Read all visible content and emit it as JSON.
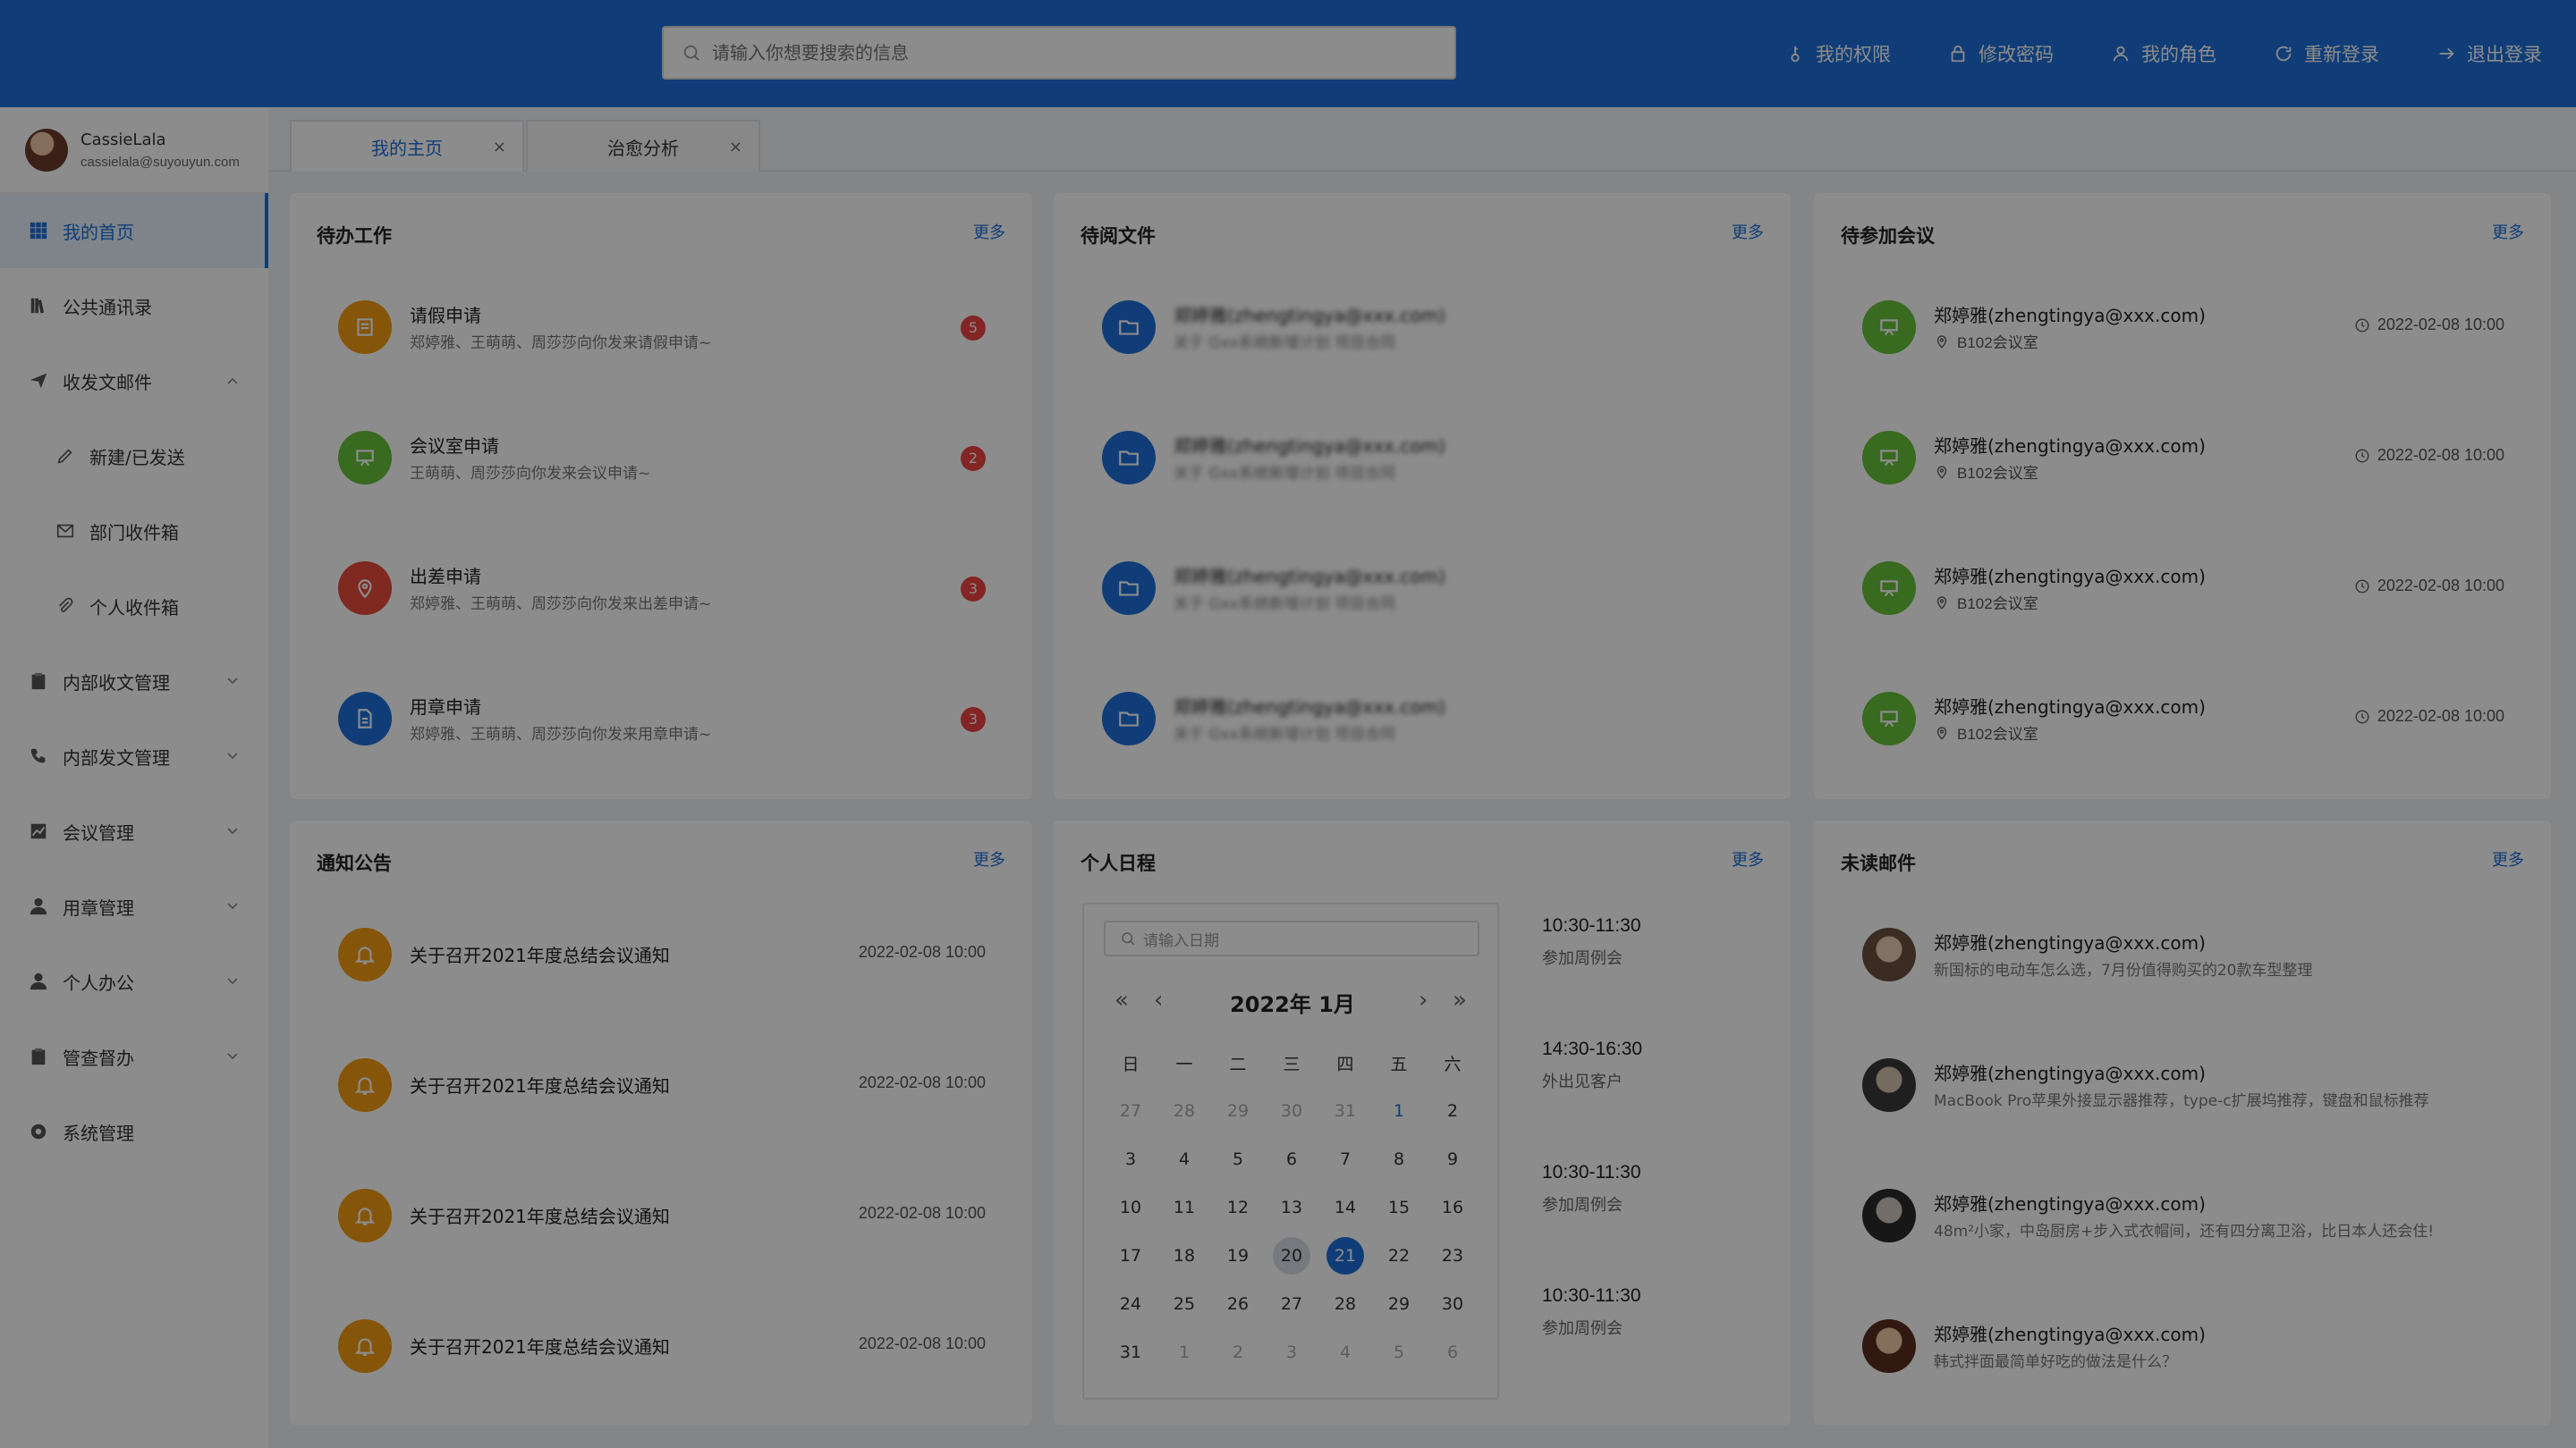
{
  "colors": {
    "primary": "#1e6fd9",
    "orange": "#f39c12",
    "green": "#67c23a",
    "red": "#e74c3c",
    "blue": "#1e6fd9"
  },
  "header": {
    "search_placeholder": "请输入你想要搜索的信息",
    "actions": [
      "我的权限",
      "修改密码",
      "我的角色",
      "重新登录",
      "退出登录"
    ]
  },
  "user": {
    "name": "CassieLala",
    "email": "cassielala@suyouyun.com"
  },
  "sidebar": {
    "items": [
      {
        "label": "我的首页",
        "icon": "grid-icon"
      },
      {
        "label": "公共通讯录",
        "icon": "book-icon"
      },
      {
        "label": "收发文邮件",
        "icon": "send-icon"
      },
      {
        "label": "新建/已发送",
        "icon": "pen-icon"
      },
      {
        "label": "部门收件箱",
        "icon": "mail-icon"
      },
      {
        "label": "个人收件箱",
        "icon": "clip-icon"
      },
      {
        "label": "内部收文管理",
        "icon": "clipboard-icon"
      },
      {
        "label": "内部发文管理",
        "icon": "phone-icon"
      },
      {
        "label": "会议管理",
        "icon": "chart-icon"
      },
      {
        "label": "用章管理",
        "icon": "person-icon"
      },
      {
        "label": "个人办公",
        "icon": "person-icon"
      },
      {
        "label": "管查督办",
        "icon": "clipboard-icon"
      },
      {
        "label": "系统管理",
        "icon": "gear-icon"
      }
    ]
  },
  "tabs": [
    {
      "label": "我的主页",
      "close": "×"
    },
    {
      "label": "治愈分析",
      "close": "×"
    }
  ],
  "more_label": "更多",
  "todo": {
    "title": "待办工作",
    "items": [
      {
        "title": "请假申请",
        "sub": "郑婷雅、王萌萌、周莎莎向你发来请假申请~",
        "count": "5"
      },
      {
        "title": "会议室申请",
        "sub": "王萌萌、周莎莎向你发来会议申请~",
        "count": "2"
      },
      {
        "title": "出差申请",
        "sub": "郑婷雅、王萌萌、周莎莎向你发来出差申请~",
        "count": "3"
      },
      {
        "title": "用章申请",
        "sub": "郑婷雅、王萌萌、周莎莎向你发来用章申请~",
        "count": "3"
      }
    ]
  },
  "files": {
    "title": "待阅文件",
    "items": [
      {
        "title": "郑婷雅(zhengtingya@xxx.com)",
        "sub": "关于 Gxx系统新增计划 项目合同"
      },
      {
        "title": "郑婷雅(zhengtingya@xxx.com)",
        "sub": "关于 Gxx系统新增计划 项目合同"
      },
      {
        "title": "郑婷雅(zhengtingya@xxx.com)",
        "sub": "关于 Gxx系统新增计划 项目合同"
      },
      {
        "title": "郑婷雅(zhengtingya@xxx.com)",
        "sub": "关于 Gxx系统新增计划 项目合同"
      }
    ]
  },
  "meetings": {
    "title": "待参加会议",
    "items": [
      {
        "title": "郑婷雅(zhengtingya@xxx.com)",
        "location": "B102会议室",
        "time": "2022-02-08 10:00"
      },
      {
        "title": "郑婷雅(zhengtingya@xxx.com)",
        "location": "B102会议室",
        "time": "2022-02-08 10:00"
      },
      {
        "title": "郑婷雅(zhengtingya@xxx.com)",
        "location": "B102会议室",
        "time": "2022-02-08 10:00"
      },
      {
        "title": "郑婷雅(zhengtingya@xxx.com)",
        "location": "B102会议室",
        "time": "2022-02-08 10:00"
      }
    ]
  },
  "notices": {
    "title": "通知公告",
    "items": [
      {
        "title": "关于召开2021年度总结会议通知",
        "time": "2022-02-08 10:00"
      },
      {
        "title": "关于召开2021年度总结会议通知",
        "time": "2022-02-08 10:00"
      },
      {
        "title": "关于召开2021年度总结会议通知",
        "time": "2022-02-08 10:00"
      },
      {
        "title": "关于召开2021年度总结会议通知",
        "time": "2022-02-08 10:00"
      }
    ]
  },
  "schedule": {
    "title": "个人日程",
    "date_placeholder": "请输入日期",
    "calendar_title": "2022年  1月",
    "weekdays": [
      "日",
      "一",
      "二",
      "三",
      "四",
      "五",
      "六"
    ],
    "days": [
      {
        "d": "27",
        "m": true
      },
      {
        "d": "28",
        "m": true
      },
      {
        "d": "29",
        "m": true
      },
      {
        "d": "30",
        "m": true
      },
      {
        "d": "31",
        "m": true
      },
      {
        "d": "1",
        "b": true
      },
      {
        "d": "2"
      },
      {
        "d": "3"
      },
      {
        "d": "4"
      },
      {
        "d": "5"
      },
      {
        "d": "6"
      },
      {
        "d": "7"
      },
      {
        "d": "8"
      },
      {
        "d": "9"
      },
      {
        "d": "10"
      },
      {
        "d": "11"
      },
      {
        "d": "12"
      },
      {
        "d": "13"
      },
      {
        "d": "14"
      },
      {
        "d": "15"
      },
      {
        "d": "16"
      },
      {
        "d": "17"
      },
      {
        "d": "18"
      },
      {
        "d": "19"
      },
      {
        "d": "20",
        "t": true
      },
      {
        "d": "21",
        "s": true
      },
      {
        "d": "22"
      },
      {
        "d": "23"
      },
      {
        "d": "24"
      },
      {
        "d": "25"
      },
      {
        "d": "26"
      },
      {
        "d": "27"
      },
      {
        "d": "28"
      },
      {
        "d": "29"
      },
      {
        "d": "30"
      },
      {
        "d": "31"
      },
      {
        "d": "1",
        "m": true
      },
      {
        "d": "2",
        "m": true
      },
      {
        "d": "3",
        "m": true
      },
      {
        "d": "4",
        "m": true
      },
      {
        "d": "5",
        "m": true
      },
      {
        "d": "6",
        "m": true
      }
    ],
    "events": [
      {
        "time": "10:30-11:30",
        "desc": "参加周例会"
      },
      {
        "time": "14:30-16:30",
        "desc": "外出见客户"
      },
      {
        "time": "10:30-11:30",
        "desc": "参加周例会"
      },
      {
        "time": "10:30-11:30",
        "desc": "参加周例会"
      }
    ]
  },
  "mails": {
    "title": "未读邮件",
    "items": [
      {
        "title": "郑婷雅(zhengtingya@xxx.com)",
        "sub": "新国标的电动车怎么选，7月份值得购买的20款车型整理"
      },
      {
        "title": "郑婷雅(zhengtingya@xxx.com)",
        "sub": "MacBook Pro苹果外接显示器推荐，type-c扩展坞推荐，键盘和鼠标推荐"
      },
      {
        "title": "郑婷雅(zhengtingya@xxx.com)",
        "sub": "48m²小家，中岛厨房+步入式衣帽间，还有四分离卫浴，比日本人还会住!"
      },
      {
        "title": "郑婷雅(zhengtingya@xxx.com)",
        "sub": "韩式拌面最简单好吃的做法是什么？"
      }
    ]
  }
}
